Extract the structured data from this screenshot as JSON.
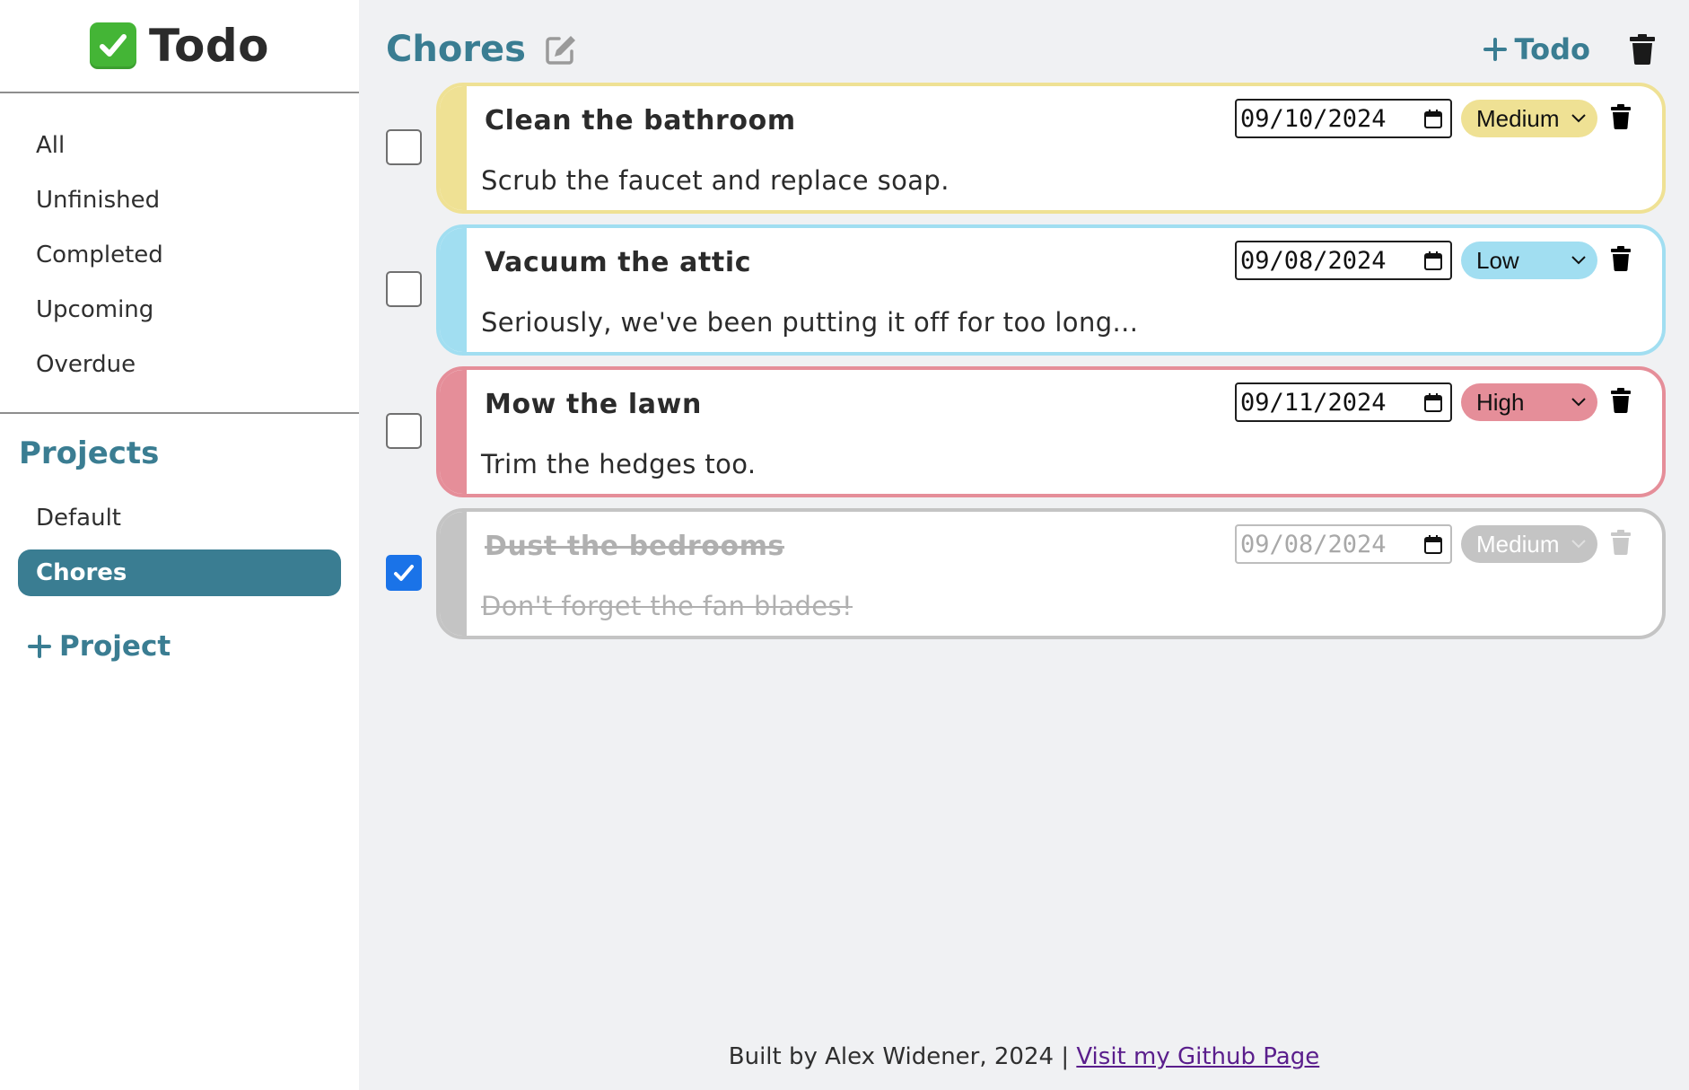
{
  "app": {
    "title": "Todo"
  },
  "filters": [
    {
      "label": "All"
    },
    {
      "label": "Unfinished"
    },
    {
      "label": "Completed"
    },
    {
      "label": "Upcoming"
    },
    {
      "label": "Overdue"
    }
  ],
  "projects": {
    "heading": "Projects",
    "items": [
      {
        "label": "Default",
        "active": false
      },
      {
        "label": "Chores",
        "active": true
      }
    ],
    "add_label": "Project"
  },
  "main": {
    "project_title": "Chores",
    "add_todo_label": "Todo"
  },
  "todos": [
    {
      "title": "Clean the bathroom",
      "description": "Scrub the faucet and replace soap.",
      "date": "09/10/2024",
      "priority": "Medium",
      "completed": false,
      "priority_color": "#efe194"
    },
    {
      "title": "Vacuum the attic",
      "description": "Seriously, we've been putting it off for too long...",
      "date": "09/08/2024",
      "priority": "Low",
      "completed": false,
      "priority_color": "#a1def1"
    },
    {
      "title": "Mow the lawn",
      "description": "Trim the hedges too.",
      "date": "09/11/2024",
      "priority": "High",
      "completed": false,
      "priority_color": "#e58e99"
    },
    {
      "title": "Dust the bedrooms",
      "description": "Don't forget the fan blades!",
      "date": "09/08/2024",
      "priority": "Medium",
      "completed": true,
      "priority_color": "#c4c4c4"
    }
  ],
  "footer": {
    "text": "Built by Alex Widener, 2024 | ",
    "link_label": "Visit my Github Page"
  },
  "colors": {
    "accent": "#3a7d92",
    "background_main": "#f0f1f3",
    "checkbox_checked": "#1a73e8"
  },
  "icons": {
    "brand": "check-mark-button-icon",
    "edit": "edit-icon",
    "add": "plus-icon",
    "trash": "trash-icon",
    "calendar": "calendar-icon",
    "dropdown": "chevron-down-icon"
  }
}
